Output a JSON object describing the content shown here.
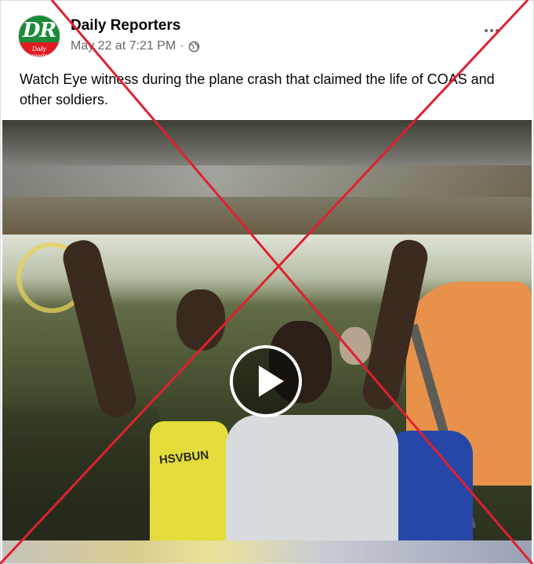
{
  "post": {
    "page_name": "Daily Reporters",
    "timestamp": "May 22 at 7:21 PM",
    "separator": "·",
    "privacy_icon": "globe-icon",
    "more_icon": "more-options-icon",
    "avatar": {
      "monogram": "DR",
      "subtitle": "Daily Reporters",
      "colors": {
        "top": "#1b8a3a",
        "bottom": "#e31b23"
      }
    },
    "caption": "Watch Eye witness during the plane crash that claimed the life of COAS and other soldiers."
  },
  "video": {
    "play_icon": "play-icon",
    "shirt_text": "HSVBUN"
  },
  "overlay": {
    "mark": "red-x-false-marker",
    "color": "#e0202e"
  }
}
